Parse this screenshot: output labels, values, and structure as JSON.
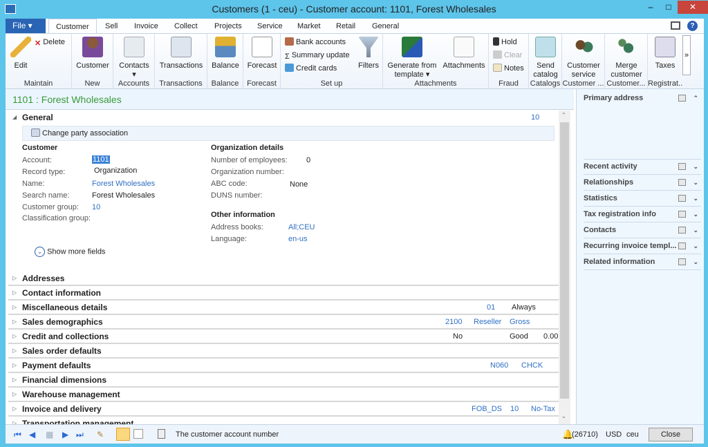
{
  "window": {
    "title": "Customers (1 - ceu) - Customer account: 1101, Forest Wholesales",
    "minimize": "–",
    "maximize": "□",
    "close": "✕"
  },
  "tabs": {
    "file": "File",
    "items": [
      "Customer",
      "Sell",
      "Invoice",
      "Collect",
      "Projects",
      "Service",
      "Market",
      "Retail",
      "General"
    ]
  },
  "ribbon": {
    "groups": [
      {
        "label": "Maintain",
        "buttons": [
          "Edit",
          "Delete"
        ]
      },
      {
        "label": "New",
        "buttons": [
          "Customer"
        ]
      },
      {
        "label": "Accounts",
        "buttons": [
          "Contacts"
        ]
      },
      {
        "label": "Transactions",
        "buttons": [
          "Transactions"
        ]
      },
      {
        "label": "Balance",
        "buttons": [
          "Balance"
        ]
      },
      {
        "label": "Forecast",
        "buttons": [
          "Forecast"
        ]
      },
      {
        "label": "Set up",
        "buttons": [
          "Bank accounts",
          "Summary update",
          "Credit cards",
          "Filters"
        ]
      },
      {
        "label": "Attachments",
        "buttons": [
          "Generate from template",
          "Attachments"
        ]
      },
      {
        "label": "Fraud",
        "buttons": [
          "Hold",
          "Clear",
          "Notes"
        ]
      },
      {
        "label": "Catalogs",
        "buttons": [
          "Send catalog"
        ]
      },
      {
        "label": "Customer ...",
        "buttons": [
          "Customer service"
        ]
      },
      {
        "label": "Customer...",
        "buttons": [
          "Merge customer"
        ]
      },
      {
        "label": "Registrat...",
        "buttons": [
          "Taxes"
        ]
      }
    ],
    "more": "»"
  },
  "form": {
    "header": "1101 : Forest Wholesales",
    "general": {
      "title": "General",
      "count": "10",
      "change_party": "Change party association",
      "customer": {
        "title": "Customer",
        "fields": [
          {
            "label": "Account:",
            "value": "1101"
          },
          {
            "label": "Record type:",
            "value": "Organization"
          },
          {
            "label": "Name:",
            "value": "Forest Wholesales"
          },
          {
            "label": "Search name:",
            "value": "Forest Wholesales"
          },
          {
            "label": "Customer group:",
            "value": "10"
          },
          {
            "label": "Classification group:",
            "value": ""
          }
        ]
      },
      "org": {
        "title": "Organization details",
        "fields": [
          {
            "label": "Number of employees:",
            "value": "0"
          },
          {
            "label": "Organization number:",
            "value": ""
          },
          {
            "label": "ABC code:",
            "value": "None"
          },
          {
            "label": "DUNS number:",
            "value": ""
          }
        ]
      },
      "other": {
        "title": "Other information",
        "fields": [
          {
            "label": "Address books:",
            "value": "All;CEU"
          },
          {
            "label": "Language:",
            "value": "en-us"
          }
        ]
      },
      "show_more": "Show more fields"
    },
    "sections": [
      {
        "title": "Addresses",
        "summary": []
      },
      {
        "title": "Contact information",
        "summary": []
      },
      {
        "title": "Miscellaneous details",
        "summary": [
          "01",
          "Always"
        ]
      },
      {
        "title": "Sales demographics",
        "summary": [
          "2100",
          "Reseller",
          "Gross"
        ]
      },
      {
        "title": "Credit and collections",
        "summary": [
          "No",
          "Good",
          "0.00"
        ]
      },
      {
        "title": "Sales order defaults",
        "summary": []
      },
      {
        "title": "Payment defaults",
        "summary": [
          "N060",
          "CHCK"
        ]
      },
      {
        "title": "Financial dimensions",
        "summary": []
      },
      {
        "title": "Warehouse management",
        "summary": []
      },
      {
        "title": "Invoice and delivery",
        "summary": [
          "FOB_DS",
          "10",
          "No-Tax"
        ]
      },
      {
        "title": "Transportation management",
        "summary": []
      }
    ]
  },
  "factbox": [
    "Primary address",
    "Recent activity",
    "Relationships",
    "Statistics",
    "Tax registration info",
    "Contacts",
    "Recurring invoice templ...",
    "Related information"
  ],
  "status": {
    "help_text": "The customer account number",
    "alerts": "(26710)",
    "currency": "USD",
    "company": "ceu",
    "close": "Close"
  }
}
